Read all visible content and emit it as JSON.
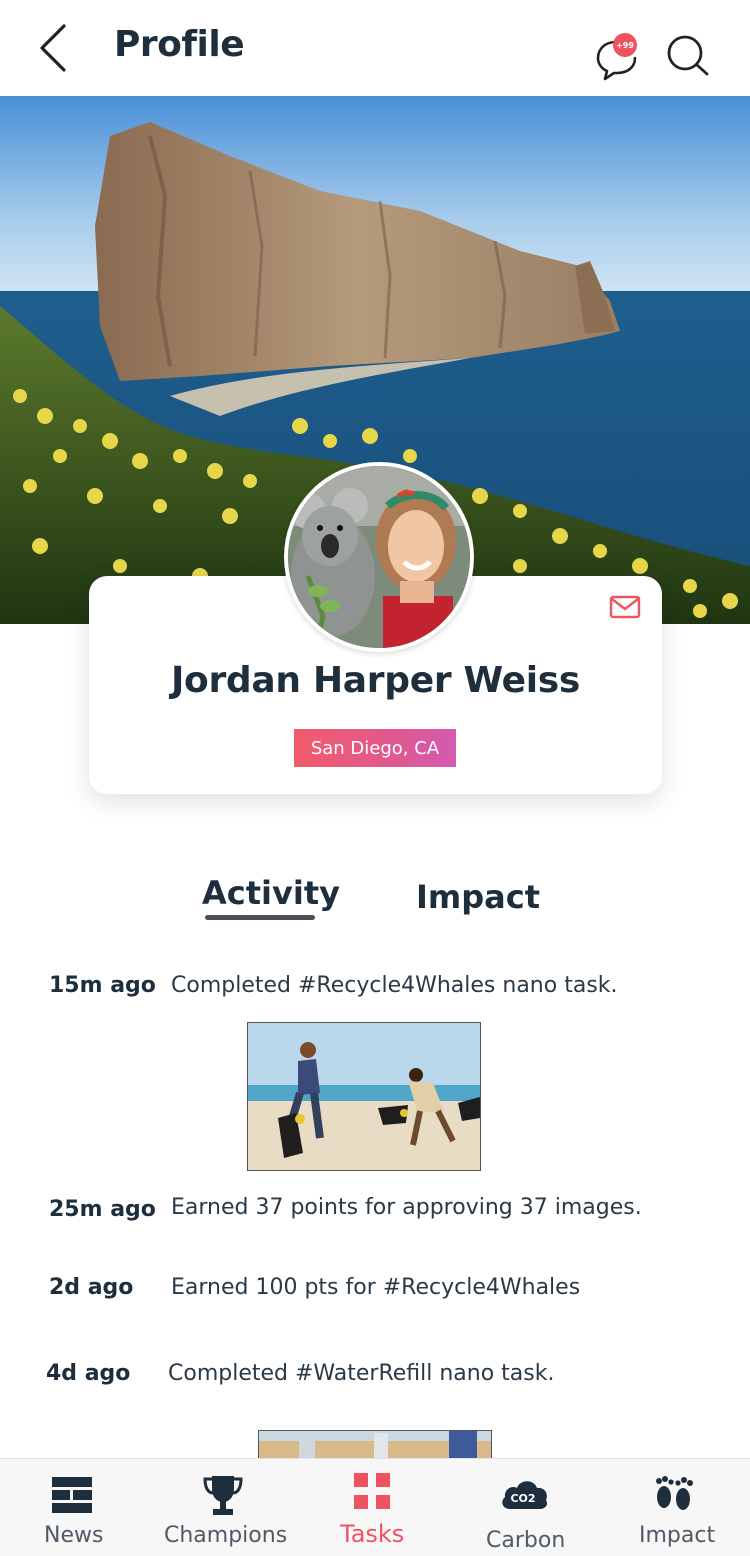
{
  "header": {
    "title": "Profile",
    "notification_badge": "+99"
  },
  "profile": {
    "name": "Jordan Harper Weiss",
    "location": "San Diego, CA"
  },
  "tabs": [
    {
      "label": "Activity",
      "active": true
    },
    {
      "label": "Impact",
      "active": false
    }
  ],
  "activity": [
    {
      "time": "15m ago",
      "text": "Completed #Recycle4Whales nano task."
    },
    {
      "time": "25m ago",
      "text": "Earned 37 points for approving 37 images."
    },
    {
      "time": "2d ago",
      "text": "Earned 100 pts for #Recycle4Whales"
    },
    {
      "time": "4d ago",
      "text": "Completed #WaterRefill nano task."
    }
  ],
  "bottom_nav": [
    {
      "label": "News",
      "icon": "news-icon",
      "active": false
    },
    {
      "label": "Champions",
      "icon": "trophy-icon",
      "active": false
    },
    {
      "label": "Tasks",
      "icon": "tasks-grid-icon",
      "active": true
    },
    {
      "label": "Carbon",
      "icon": "co2-cloud-icon",
      "active": false
    },
    {
      "label": "Impact",
      "icon": "footprints-icon",
      "active": false
    }
  ],
  "carbon_icon_text": "CO2",
  "colors": {
    "accent": "#ef5361",
    "text_dark": "#1f2e3d",
    "badge_gradient_start": "#f25c6a",
    "badge_gradient_end": "#d45bb2"
  }
}
